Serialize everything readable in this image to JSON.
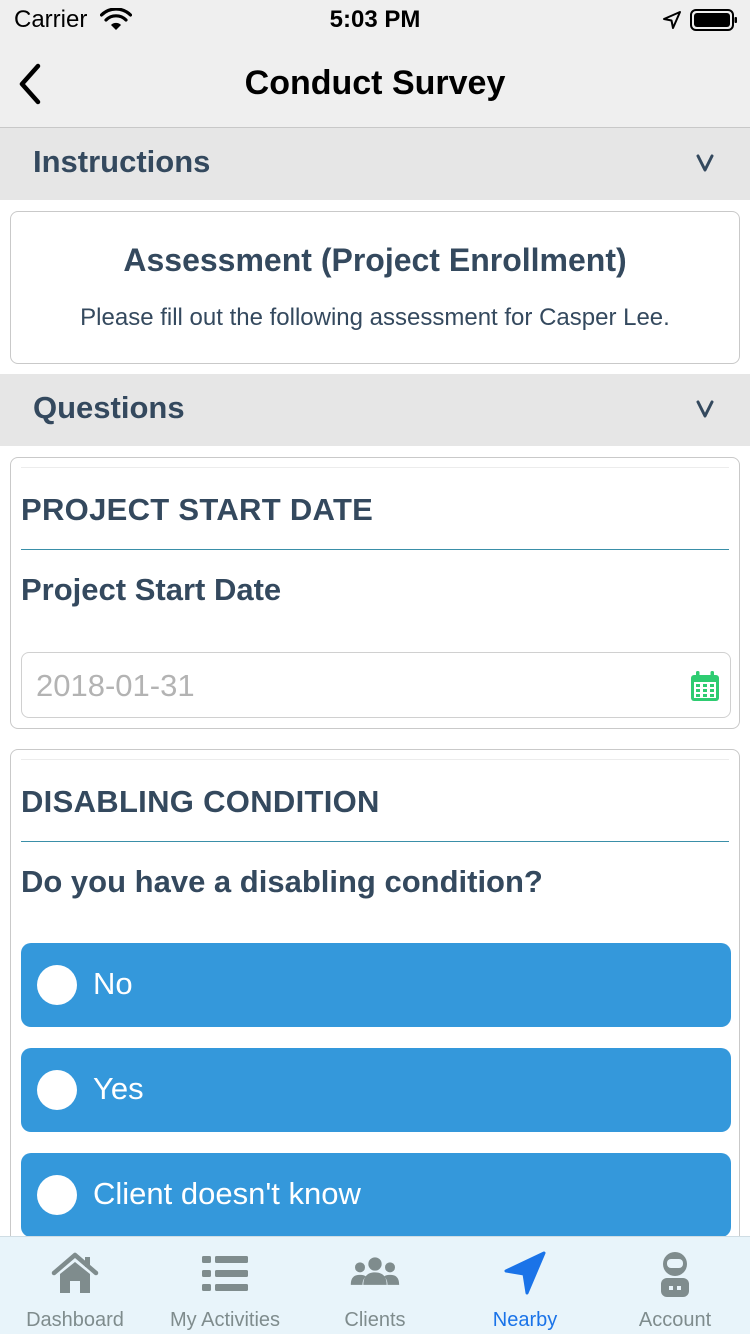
{
  "status_bar": {
    "carrier": "Carrier",
    "time": "5:03 PM"
  },
  "nav": {
    "title": "Conduct Survey",
    "back_icon": "chevron-left-icon"
  },
  "instructions": {
    "header": "Instructions",
    "chevron": "v",
    "title": "Assessment (Project Enrollment)",
    "text": "Please fill out the following assessment for Casper Lee."
  },
  "questions": {
    "header": "Questions",
    "chevron": "v",
    "items": [
      {
        "heading": "PROJECT START DATE",
        "label": "Project Start Date",
        "type": "date",
        "placeholder": "2018-01-31",
        "icon": "calendar-icon"
      },
      {
        "heading": "DISABLING CONDITION",
        "label": "Do you have a disabling condition?",
        "type": "radio",
        "options": [
          "No",
          "Yes",
          "Client doesn't know"
        ]
      }
    ]
  },
  "tabs": [
    {
      "label": "Dashboard",
      "icon": "home-icon",
      "active": false
    },
    {
      "label": "My Activities",
      "icon": "list-icon",
      "active": false
    },
    {
      "label": "Clients",
      "icon": "users-icon",
      "active": false
    },
    {
      "label": "Nearby",
      "icon": "location-arrow-icon",
      "active": true
    },
    {
      "label": "Account",
      "icon": "astronaut-icon",
      "active": false
    }
  ],
  "colors": {
    "accent": "#3498db",
    "active_tab": "#1a73e8",
    "inactive_tab": "#7f8c8d",
    "calendar": "#2ecc71",
    "text": "#34495e"
  }
}
